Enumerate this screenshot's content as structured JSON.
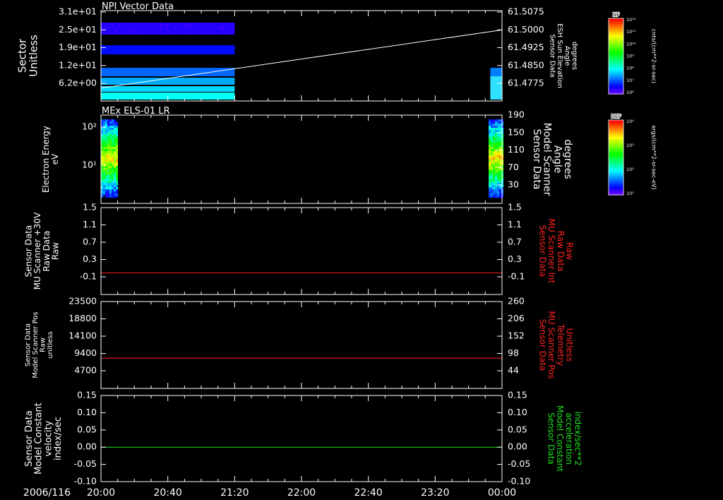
{
  "date_label": "2006/116",
  "x_ticks": [
    "20:00",
    "20:40",
    "21:20",
    "22:00",
    "22:40",
    "23:20",
    "00:00"
  ],
  "colorbars": [
    {
      "badge": "NF",
      "ticks": [
        "10¹²",
        "10¹¹",
        "10¹⁰",
        "10⁹",
        "10⁸",
        "10⁷",
        "10⁶"
      ],
      "units": "cnts/(cm**2-sr-sec)"
    },
    {
      "badge": "DEF",
      "ticks": [
        "10⁴",
        "10³",
        "10²",
        "10¹"
      ],
      "units": "ergs/(cm**2-sr-sec-eV)"
    }
  ],
  "chart_data": [
    {
      "type": "heatmap",
      "title": "NPI Vector Data",
      "ylabel": [
        "Sector",
        "Unitless"
      ],
      "y_ticks": [
        "3.1e+01",
        "2.5e+01",
        "1.9e+01",
        "1.2e+01",
        "6.2e+00"
      ],
      "y2label": [
        "Sensor Data",
        "ESH Sun Elevation",
        "Angle",
        "degrees"
      ],
      "y2_ticks": [
        "61.5075",
        "61.5000",
        "61.4925",
        "61.4850",
        "61.4775"
      ],
      "y2_range": [
        61.4725,
        61.5075
      ],
      "line_series": {
        "color": "#ffffff",
        "x": [
          "20:00",
          "00:00"
        ],
        "y": [
          61.4775,
          61.5
        ]
      },
      "data_coverage": [
        [
          "20:00",
          "21:20"
        ],
        [
          "23:53",
          "00:00"
        ]
      ]
    },
    {
      "type": "heatmap",
      "title": "MEx ELS-01 LR",
      "ylabel": [
        "Electron Energy",
        "eV"
      ],
      "y_ticks": [
        "10²",
        "10¹"
      ],
      "ylim": [
        1,
        150
      ],
      "y_scale": "log",
      "y2label": [
        "Sensor Data",
        "Model Scanner",
        "Angle",
        "degrees"
      ],
      "y2_ticks": [
        "190",
        "150",
        "110",
        "70",
        "30"
      ],
      "y2_range": [
        10,
        190
      ],
      "line_series": {
        "color": "#ffffff",
        "x": [
          "20:00",
          "00:00"
        ],
        "y": [
          10,
          10
        ]
      },
      "data_coverage": [
        [
          "20:00",
          "20:09"
        ],
        [
          "23:52",
          "00:00"
        ]
      ]
    },
    {
      "type": "line",
      "ylabel": [
        "Sensor Data",
        "MU Scanner +30V",
        "Raw Data",
        "Raw"
      ],
      "y_ticks": [
        "1.5",
        "1.1",
        "0.7",
        "0.3",
        "-0.1"
      ],
      "ylim": [
        -0.5,
        1.5
      ],
      "y2label": [
        "Sensor Data",
        "MU Scanner Int",
        "Raw Data",
        "Raw"
      ],
      "y2_ticks": [
        "1.5",
        "1.1",
        "0.7",
        "0.3",
        "-0.1"
      ],
      "y2_color": "#ff2020",
      "series": [
        {
          "color": "#ff2020",
          "x": [
            "20:00",
            "00:00"
          ],
          "y": [
            0,
            0
          ]
        }
      ]
    },
    {
      "type": "line",
      "ylabel": [
        "Sensor Data",
        "Model Scanner Pos",
        "Raw",
        "unitless"
      ],
      "y_ticks": [
        "23500",
        "18800",
        "14100",
        "9400",
        "4700"
      ],
      "ylim": [
        0,
        23500
      ],
      "y2label": [
        "Sensor Data",
        "MU Scanner Pos",
        "Telemetry",
        "Unitless"
      ],
      "y2_ticks": [
        "260",
        "206",
        "152",
        "98",
        "44"
      ],
      "y2_color": "#ff2020",
      "series": [
        {
          "color": "#ff2020",
          "x": [
            "20:00",
            "00:00"
          ],
          "y": [
            8200,
            8200
          ]
        }
      ]
    },
    {
      "type": "line",
      "ylabel": [
        "Sensor Data",
        "Model Constant",
        "velocity",
        "index/sec"
      ],
      "y_ticks": [
        "0.15",
        "0.10",
        "0.05",
        "0.00",
        "-0.05",
        "-0.10"
      ],
      "ylim": [
        -0.1,
        0.15
      ],
      "y2label": [
        "Sensor Data",
        "Model Constant",
        "acceleration",
        "index/sec**2"
      ],
      "y2_ticks": [
        "0.15",
        "0.10",
        "0.05",
        "0.00",
        "-0.05",
        "-0.10"
      ],
      "y2_color": "#20e020",
      "series": [
        {
          "color": "#20e020",
          "x": [
            "20:00",
            "00:00"
          ],
          "y": [
            0,
            0
          ]
        }
      ]
    }
  ]
}
